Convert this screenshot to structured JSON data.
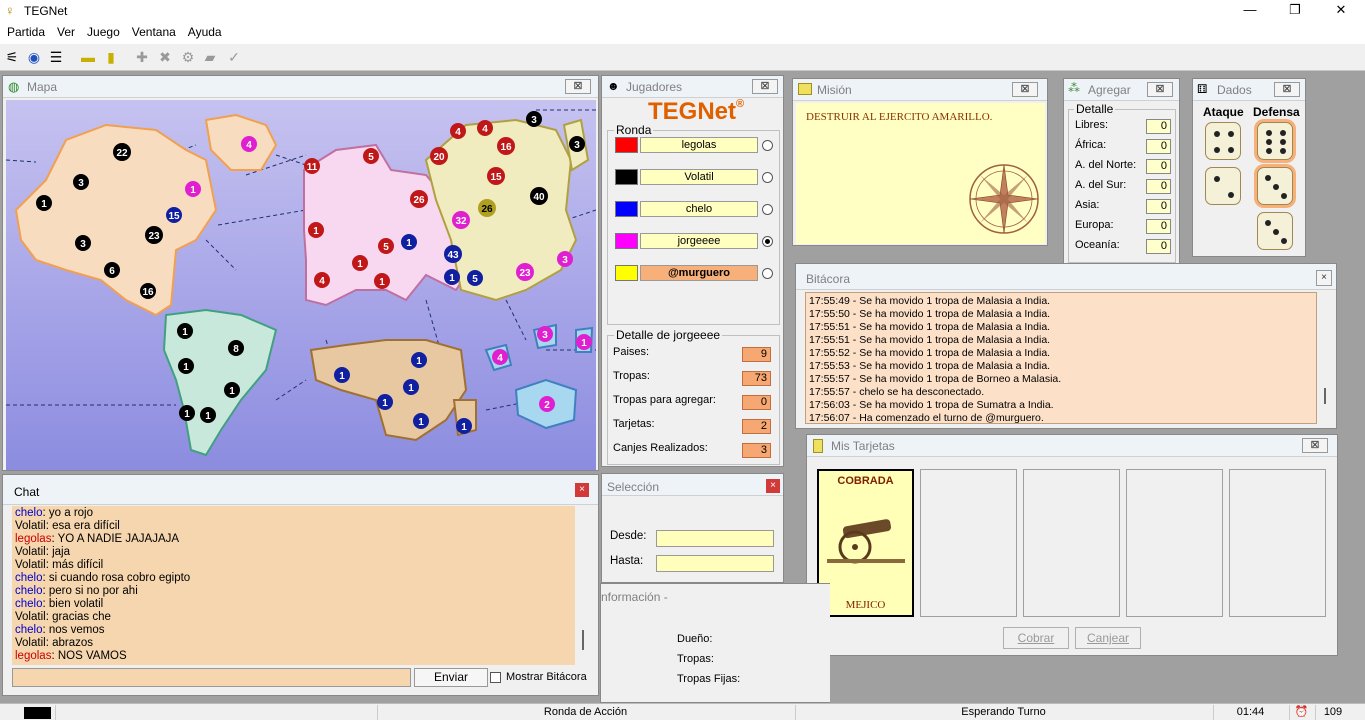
{
  "app": {
    "title": "TEGNet",
    "menu": [
      "Partida",
      "Ver",
      "Juego",
      "Ventana",
      "Ayuda"
    ]
  },
  "toolbar": {
    "icons": [
      "connect-icon",
      "globe-icon",
      "list-icon",
      "yellow-card-icon",
      "mission-icon",
      "add-icon",
      "remove-icon",
      "gear-icon",
      "card-icon",
      "check-icon"
    ]
  },
  "map_panel": {
    "title": "Mapa"
  },
  "players_panel": {
    "title": "Jugadores",
    "logo": "TEGNet",
    "logo_reg": "®",
    "ronda_label": "Ronda",
    "players": [
      {
        "name": "legolas",
        "color": "#ff0000",
        "selected": false
      },
      {
        "name": "Volatil",
        "color": "#000000",
        "selected": false
      },
      {
        "name": "chelo",
        "color": "#0000ff",
        "selected": false
      },
      {
        "name": "jorgeeee",
        "color": "#ff00ff",
        "selected": true
      },
      {
        "name": "@murguero",
        "color": "#ffff00",
        "selected": false
      }
    ],
    "detail_label": "Detalle de jorgeeee",
    "details": [
      {
        "label": "Paises:",
        "value": "9"
      },
      {
        "label": "Tropas:",
        "value": "73"
      },
      {
        "label": "Tropas para agregar:",
        "value": "0"
      },
      {
        "label": "Tarjetas:",
        "value": "2"
      },
      {
        "label": "Canjes Realizados:",
        "value": "3"
      }
    ]
  },
  "mission_panel": {
    "title": "Misión",
    "text": "DESTRUIR AL EJERCITO AMARILLO."
  },
  "agregar_panel": {
    "title": "Agregar",
    "group": "Detalle",
    "rows": [
      {
        "label": "Libres:",
        "value": "0"
      },
      {
        "label": "África:",
        "value": "0"
      },
      {
        "label": "A. del Norte:",
        "value": "0"
      },
      {
        "label": "A. del Sur:",
        "value": "0"
      },
      {
        "label": "Asia:",
        "value": "0"
      },
      {
        "label": "Europa:",
        "value": "0"
      },
      {
        "label": "Oceanía:",
        "value": "0"
      }
    ]
  },
  "dice_panel": {
    "title": "Dados",
    "attack_label": "Ataque",
    "defense_label": "Defensa",
    "attack": [
      4,
      2
    ],
    "defense": [
      6,
      3,
      3
    ]
  },
  "log_panel": {
    "title": "Bitácora",
    "lines": [
      "17:55:49 - Se ha movido 1 tropa de Malasia a India.",
      "17:55:50 - Se ha movido 1 tropa de Malasia a India.",
      "17:55:51 - Se ha movido 1 tropa de Malasia a India.",
      "17:55:51 - Se ha movido 1 tropa de Malasia a India.",
      "17:55:52 - Se ha movido 1 tropa de Malasia a India.",
      "17:55:53 - Se ha movido 1 tropa de Malasia a India.",
      "17:55:57 - Se ha movido 1 tropa de Borneo a Malasia.",
      "17:55:57 - chelo se ha desconectado.",
      "17:56:03 - Se ha movido 1 tropa de Sumatra a India.",
      "17:56:07 - Ha comenzado el turno de @murguero."
    ]
  },
  "cards_panel": {
    "title": "Mis Tarjetas",
    "card": {
      "status": "COBRADA",
      "country": "MEJICO"
    },
    "cobrar_button": "Cobrar",
    "canjear_button": "Canjear"
  },
  "chat_panel": {
    "title": "Chat",
    "messages": [
      {
        "user": "chelo",
        "text": "yo a rojo",
        "color": "#0000cc"
      },
      {
        "user": "Volatil",
        "text": "esa era difícil",
        "color": "#000000"
      },
      {
        "user": "legolas",
        "text": "YO A NADIE JAJAJAJA",
        "color": "#cc0000"
      },
      {
        "user": "Volatil",
        "text": "jaja",
        "color": "#000000"
      },
      {
        "user": "Volatil",
        "text": "más difícil",
        "color": "#000000"
      },
      {
        "user": "chelo",
        "text": "si cuando rosa cobro egipto",
        "color": "#0000cc"
      },
      {
        "user": "chelo",
        "text": "pero si no por ahi",
        "color": "#0000cc"
      },
      {
        "user": "chelo",
        "text": "bien volatil",
        "color": "#0000cc"
      },
      {
        "user": "Volatil",
        "text": "gracias che",
        "color": "#000000"
      },
      {
        "user": "chelo",
        "text": "nos vemos",
        "color": "#0000cc"
      },
      {
        "user": "Volatil",
        "text": "abrazos",
        "color": "#000000"
      },
      {
        "user": "legolas",
        "text": "NOS VAMOS",
        "color": "#cc0000"
      }
    ],
    "send_button": "Enviar",
    "show_log_label": "Mostrar Bitácora"
  },
  "selection_panel": {
    "title": "Selección",
    "desde_label": "Desde:",
    "hasta_label": "Hasta:"
  },
  "info_panel": {
    "title": "nformación -",
    "dueno_label": "Dueño:",
    "tropas_label": "Tropas:",
    "fijas_label": "Tropas Fijas:"
  },
  "statusbar": {
    "phase": "Ronda de Acción",
    "state": "Esperando Turno",
    "time": "01:44",
    "count": "109"
  }
}
